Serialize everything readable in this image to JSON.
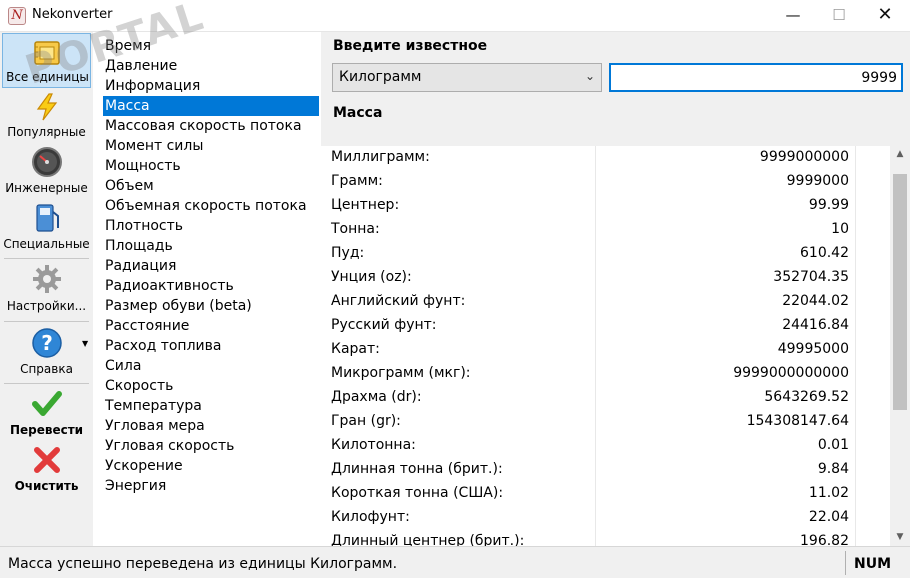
{
  "window": {
    "title": "Nekonverter",
    "icon_letter": "N"
  },
  "toolbar": {
    "items": [
      {
        "label": "Все единицы",
        "icon": "all-units-icon",
        "selected": true
      },
      {
        "label": "Популярные",
        "icon": "lightning-icon"
      },
      {
        "label": "Инженерные",
        "icon": "gauge-icon"
      },
      {
        "label": "Специальные",
        "icon": "fuel-pump-icon"
      },
      {
        "label": "Настройки...",
        "icon": "gear-icon"
      },
      {
        "label": "Справка",
        "icon": "help-icon"
      },
      {
        "label": "Перевести",
        "icon": "checkmark-icon"
      },
      {
        "label": "Очистить",
        "icon": "x-icon"
      }
    ]
  },
  "categories": [
    "Время",
    "Давление",
    "Информация",
    "Масса",
    "Массовая скорость потока",
    "Момент силы",
    "Мощность",
    "Объем",
    "Объемная скорость потока",
    "Плотность",
    "Площадь",
    "Радиация",
    "Радиоактивность",
    "Размер обуви (beta)",
    "Расстояние",
    "Расход топлива",
    "Сила",
    "Скорость",
    "Температура",
    "Угловая мера",
    "Угловая скорость",
    "Ускорение",
    "Энергия"
  ],
  "selected_category": "Масса",
  "input": {
    "label": "Введите известное",
    "unit": "Килограмм",
    "value": "9999"
  },
  "section_title": "Масса",
  "results": [
    {
      "name": "Миллиграмм:",
      "value": "9999000000"
    },
    {
      "name": "Грамм:",
      "value": "9999000"
    },
    {
      "name": "Центнер:",
      "value": "99.99"
    },
    {
      "name": "Тонна:",
      "value": "10"
    },
    {
      "name": "Пуд:",
      "value": "610.42"
    },
    {
      "name": "Унция (oz):",
      "value": "352704.35"
    },
    {
      "name": "Английский фунт:",
      "value": "22044.02"
    },
    {
      "name": "Русский фунт:",
      "value": "24416.84"
    },
    {
      "name": "Карат:",
      "value": "49995000"
    },
    {
      "name": "Микрограмм (мкг):",
      "value": "9999000000000"
    },
    {
      "name": "Драхма (dr):",
      "value": "5643269.52"
    },
    {
      "name": "Гран (gr):",
      "value": "154308147.64"
    },
    {
      "name": "Килотонна:",
      "value": "0.01"
    },
    {
      "name": "Длинная тонна (брит.):",
      "value": "9.84"
    },
    {
      "name": "Короткая тонна (США):",
      "value": "11.02"
    },
    {
      "name": "Килофунт:",
      "value": "22.04"
    },
    {
      "name": "Длинный центнер (брит.):",
      "value": "196.82"
    }
  ],
  "status": {
    "message": "Масса успешно переведена из единицы Килограмм.",
    "indicator": "NUM"
  },
  "watermark": "PORTAL",
  "colors": {
    "selection": "#0078d7",
    "toolbar_selected": "#cce4f7"
  }
}
